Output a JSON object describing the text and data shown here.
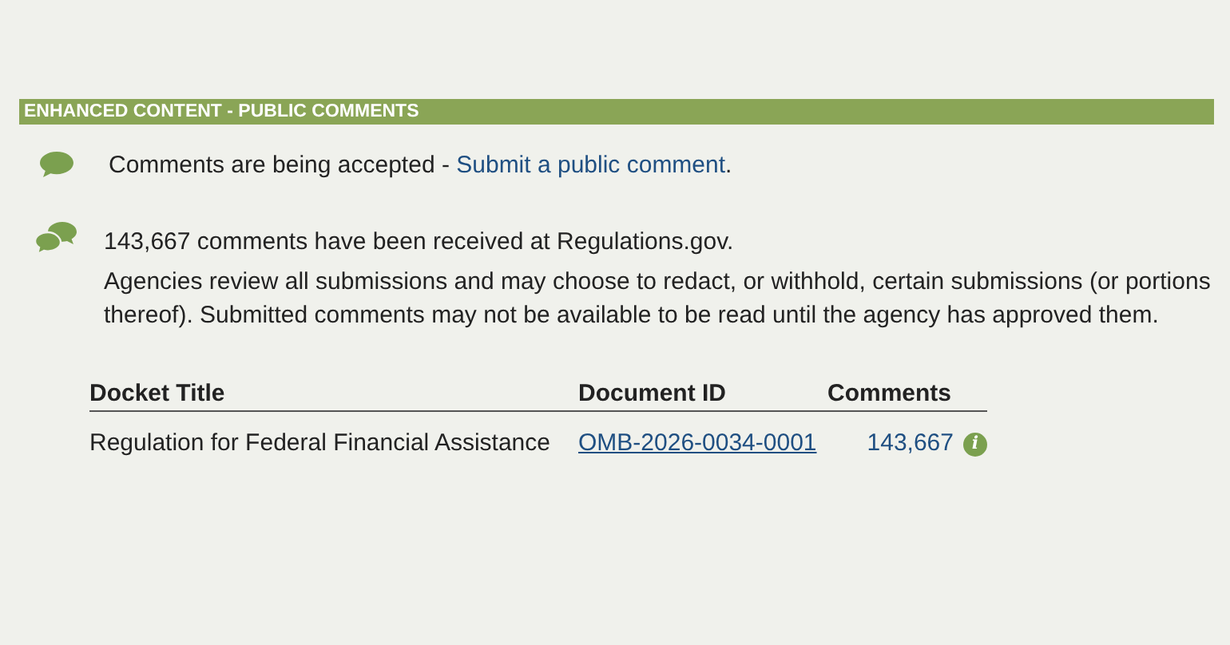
{
  "section": {
    "title": "ENHANCED CONTENT - PUBLIC COMMENTS"
  },
  "status": {
    "text": "Comments are being accepted - ",
    "link": "Submit a public comment",
    "after": "."
  },
  "received": {
    "text": "143,667 comments have been received at Regulations.gov.",
    "note": "Agencies review all submissions and may choose to redact, or withhold, certain submissions (or portions thereof). Submitted comments may not be available to be read until the agency has approved them."
  },
  "table": {
    "columns": [
      "Docket Title",
      "Document ID",
      "Comments"
    ],
    "rows": [
      {
        "docket_title": "Regulation for Federal Financial Assistance",
        "document_id": "OMB-2026-0034-0001",
        "comments": "143,667",
        "info": "i"
      }
    ]
  }
}
